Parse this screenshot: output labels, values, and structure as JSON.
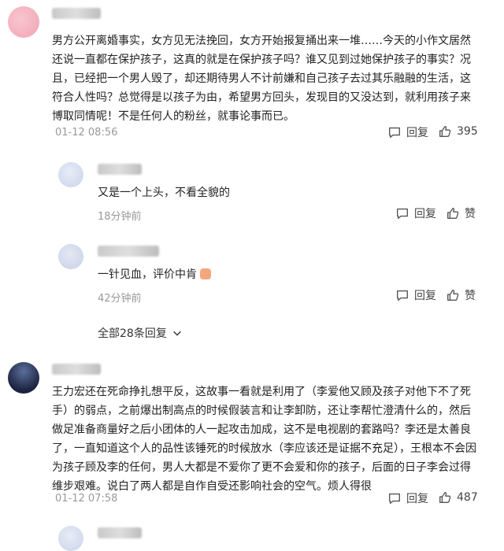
{
  "comments": [
    {
      "text": "男方公开离婚事实，女方见无法挽回，女方开始报复捅出来一堆……今天的小作文居然还说一直都在保护孩子，这真的就是在保护孩子吗？谁又见到过她保护孩子的事实？况且，已经把一个男人毁了，却还期待男人不计前嫌和自己孩子去过其乐融融的生活，这符合人性吗？总觉得是以孩子为由，希望男方回头，发现目的又没达到，就利用孩子来博取同情呢！不是任何人的粉丝，就事论事而已。",
      "time": "01-12 08:56",
      "reply_label": "回复",
      "likes": "395",
      "replies": [
        {
          "text": "又是一个上头，不看全貌的",
          "time": "18分钟前",
          "reply_label": "回复",
          "like_label": "赞"
        },
        {
          "text": "一针见血，评价中肯",
          "time": "42分钟前",
          "reply_label": "回复",
          "like_label": "赞"
        }
      ],
      "more_replies": "全部28条回复"
    },
    {
      "text": "王力宏还在死命挣扎想平反，这故事一看就是利用了（李爱他又顾及孩子对他下不了死手）的弱点，之前爆出制高点的时候假装言和让李卸防，还让李帮忙澄清什么的，然后做足准备商量好之后小团体的人一起攻击加成，这不是电视剧的套路吗？李还是太善良了，一直知道这个人的品性该锤死的时候放水（李应该还是证据不充足），王根本不会因为孩子顾及李的任何，男人大都是不爱你了更不会爱和你的孩子，后面的日子李会过得维步艰难。说白了两人都是自作自受还影响社会的空气。烦人得很",
      "time": "01-12 07:58",
      "reply_label": "回复",
      "likes": "487"
    }
  ],
  "colors": {
    "accent": "#1a66d6",
    "muted": "#999999"
  }
}
